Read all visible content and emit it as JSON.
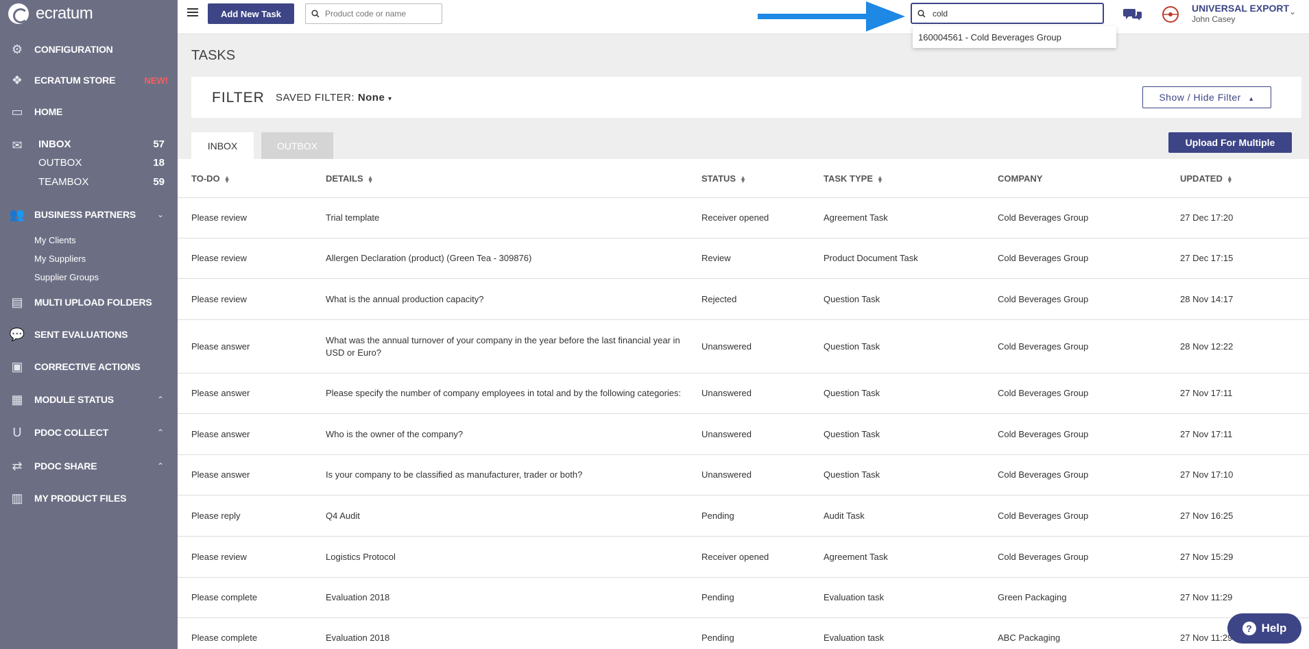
{
  "app": {
    "logo_text": "ecratum"
  },
  "sidebar": {
    "configuration": "CONFIGURATION",
    "store": "ECRATUM STORE",
    "store_badge": "NEW!",
    "home": "HOME",
    "inbox": {
      "label": "INBOX",
      "count": "57"
    },
    "outbox": {
      "label": "OUTBOX",
      "count": "18"
    },
    "teambox": {
      "label": "TEAMBOX",
      "count": "59"
    },
    "business_partners": "BUSINESS PARTNERS",
    "my_clients": "My Clients",
    "my_suppliers": "My Suppliers",
    "supplier_groups": "Supplier Groups",
    "multi_upload": "MULTI UPLOAD FOLDERS",
    "sent_evaluations": "SENT EVALUATIONS",
    "corrective_actions": "CORRECTIVE ACTIONS",
    "module_status": "MODULE STATUS",
    "pdoc_collect": "PDOC COLLECT",
    "pdoc_share": "PDOC SHARE",
    "my_product_files": "MY PRODUCT FILES"
  },
  "topbar": {
    "add_task": "Add New Task",
    "product_search_placeholder": "Product code or name",
    "main_search_value": "cold",
    "suggestion": "160004561 - Cold Beverages Group",
    "company": "UNIVERSAL EXPORT",
    "user": "John Casey"
  },
  "page": {
    "title": "TASKS",
    "filter_title": "FILTER",
    "saved_filter_label": "SAVED FILTER:",
    "saved_filter_value": "None",
    "show_hide": "Show / Hide Filter",
    "tab_inbox": "INBOX",
    "tab_outbox": "OUTBOX",
    "upload_multiple": "Upload For Multiple"
  },
  "table": {
    "headers": {
      "todo": "TO-DO",
      "details": "DETAILS",
      "status": "STATUS",
      "task_type": "TASK TYPE",
      "company": "COMPANY",
      "updated": "UPDATED"
    },
    "rows": [
      {
        "todo": "Please review",
        "details": "Trial template",
        "status": "Receiver opened",
        "type": "Agreement Task",
        "company": "Cold Beverages Group",
        "updated": "27 Dec 17:20"
      },
      {
        "todo": "Please review",
        "details": "Allergen Declaration (product) (Green Tea - 309876)",
        "status": "Review",
        "type": "Product Document Task",
        "company": "Cold Beverages Group",
        "updated": "27 Dec 17:15"
      },
      {
        "todo": "Please review",
        "details": "What is the annual production capacity?",
        "status": "Rejected",
        "type": "Question Task",
        "company": "Cold Beverages Group",
        "updated": "28 Nov 14:17"
      },
      {
        "todo": "Please answer",
        "details": "What was the annual turnover of your company in the year before the last financial year in USD or Euro?",
        "status": "Unanswered",
        "type": "Question Task",
        "company": "Cold Beverages Group",
        "updated": "28 Nov 12:22"
      },
      {
        "todo": "Please answer",
        "details": "Please specify the number of company employees in total and by the following categories:",
        "status": "Unanswered",
        "type": "Question Task",
        "company": "Cold Beverages Group",
        "updated": "27 Nov 17:11"
      },
      {
        "todo": "Please answer",
        "details": "Who is the owner of the company?",
        "status": "Unanswered",
        "type": "Question Task",
        "company": "Cold Beverages Group",
        "updated": "27 Nov 17:11"
      },
      {
        "todo": "Please answer",
        "details": "Is your company to be classified as manufacturer, trader or both?",
        "status": "Unanswered",
        "type": "Question Task",
        "company": "Cold Beverages Group",
        "updated": "27 Nov 17:10"
      },
      {
        "todo": "Please reply",
        "details": "Q4 Audit",
        "status": "Pending",
        "type": "Audit Task",
        "company": "Cold Beverages Group",
        "updated": "27 Nov 16:25"
      },
      {
        "todo": "Please review",
        "details": "Logistics Protocol",
        "status": "Receiver opened",
        "type": "Agreement Task",
        "company": "Cold Beverages Group",
        "updated": "27 Nov 15:29"
      },
      {
        "todo": "Please complete",
        "details": "Evaluation 2018",
        "status": "Pending",
        "type": "Evaluation task",
        "company": "Green Packaging",
        "updated": "27 Nov 11:29"
      },
      {
        "todo": "Please complete",
        "details": "Evaluation 2018",
        "status": "Pending",
        "type": "Evaluation task",
        "company": "ABC Packaging",
        "updated": "27 Nov 11:29"
      }
    ]
  },
  "help": "Help",
  "colors": {
    "sidebar": "#6c6f84",
    "primary": "#3d4586",
    "accent_arrow": "#1e88e5",
    "badge_new": "#ff5b5b"
  }
}
